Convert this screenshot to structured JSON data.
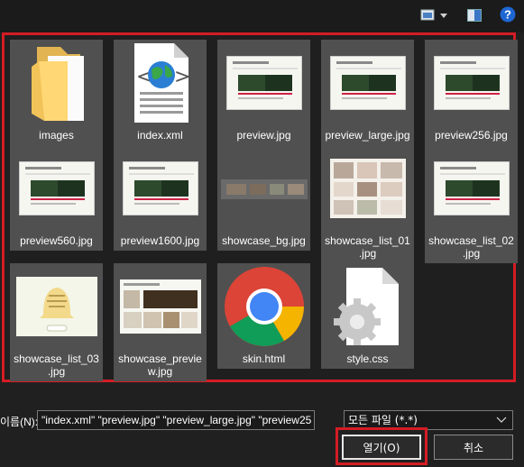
{
  "toolbar": {
    "view_icon": "view-mode-icon",
    "pane_icon": "preview-pane-icon",
    "help_icon": "help-icon",
    "help_label": "?"
  },
  "files": [
    {
      "name": "images",
      "icon": "folder-icon"
    },
    {
      "name": "index.xml",
      "icon": "xml-file-icon"
    },
    {
      "name": "preview.jpg",
      "icon": "image-thumbnail"
    },
    {
      "name": "preview_large.jpg",
      "icon": "image-thumbnail"
    },
    {
      "name": "preview256.jpg",
      "icon": "image-thumbnail"
    },
    {
      "name": "preview560.jpg",
      "icon": "image-thumbnail"
    },
    {
      "name": "preview1600.jpg",
      "icon": "image-thumbnail"
    },
    {
      "name": "showcase_bg.jpg",
      "icon": "image-thumbnail"
    },
    {
      "name": "showcase_list_01.jpg",
      "icon": "image-thumbnail"
    },
    {
      "name": "showcase_list_02.jpg",
      "icon": "image-thumbnail"
    },
    {
      "name": "showcase_list_03.jpg",
      "icon": "image-thumbnail"
    },
    {
      "name": "showcase_preview.jpg",
      "icon": "image-thumbnail"
    },
    {
      "name": "skin.html",
      "icon": "chrome-icon"
    },
    {
      "name": "style.css",
      "icon": "css-file-icon"
    }
  ],
  "file_labels": {
    "images": "images",
    "index_xml": "index.xml",
    "preview": "preview.jpg",
    "preview_large": "preview_large.jpg",
    "preview256": "preview256.jpg",
    "preview560": "preview560.jpg",
    "preview1600": "preview1600.jpg",
    "showcase_bg": "showcase_bg.jpg",
    "showcase_list_01_a": "showcase_list_01",
    "showcase_list_01_b": ".jpg",
    "showcase_list_02_a": "showcase_list_02",
    "showcase_list_02_b": ".jpg",
    "showcase_list_03_a": "showcase_list_03",
    "showcase_list_03_b": ".jpg",
    "showcase_preview_a": "showcase_previe",
    "showcase_preview_b": "w.jpg",
    "skin_html": "skin.html",
    "style_css": "style.css"
  },
  "footer": {
    "filename_label": "이름(N):",
    "filename_value": "\"index.xml\" \"preview.jpg\" \"preview_large.jpg\" \"preview25",
    "filter_value": "모든 파일 (*.*)",
    "open_label": "열기(O)",
    "cancel_label": "취소"
  },
  "colors": {
    "highlight": "#d41c24",
    "tile_bg": "#505050",
    "window_bg": "#202020"
  }
}
